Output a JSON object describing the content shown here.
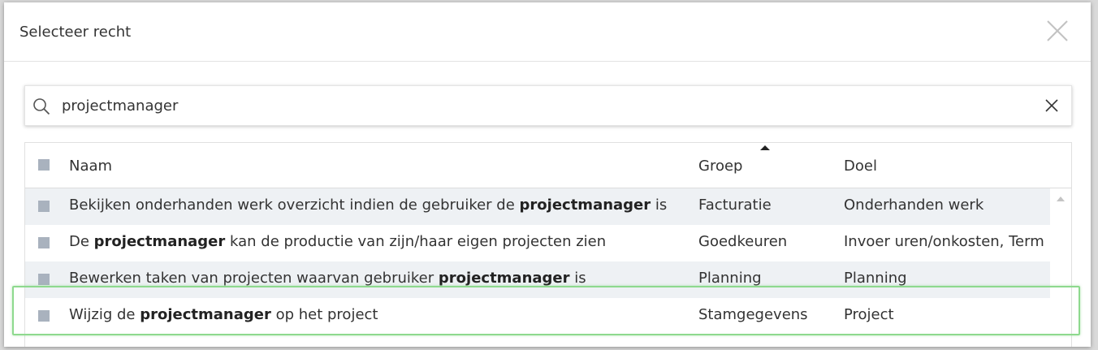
{
  "dialog": {
    "title": "Selecteer recht"
  },
  "search": {
    "value": "projectmanager",
    "placeholder": ""
  },
  "table": {
    "columns": {
      "naam": "Naam",
      "groep": "Groep",
      "doel": "Doel"
    },
    "sorted_column": "Groep",
    "rows": [
      {
        "naam": [
          {
            "text": "Bekijken onderhanden werk overzicht indien de gebruiker de ",
            "bold": false
          },
          {
            "text": "projectmanager",
            "bold": true
          },
          {
            "text": " is",
            "bold": false
          }
        ],
        "groep": "Facturatie",
        "doel": "Onderhanden werk"
      },
      {
        "naam": [
          {
            "text": "De ",
            "bold": false
          },
          {
            "text": "projectmanager",
            "bold": true
          },
          {
            "text": " kan de productie van zijn/haar eigen projecten zien",
            "bold": false
          }
        ],
        "groep": "Goedkeuren",
        "doel": "Invoer uren/onkosten, Term"
      },
      {
        "naam": [
          {
            "text": "Bewerken taken van projecten waarvan gebruiker ",
            "bold": false
          },
          {
            "text": "projectmanager",
            "bold": true
          },
          {
            "text": " is",
            "bold": false
          }
        ],
        "groep": "Planning",
        "doel": "Planning"
      },
      {
        "naam": [
          {
            "text": "Wijzig de ",
            "bold": false
          },
          {
            "text": "projectmanager",
            "bold": true
          },
          {
            "text": " op het project",
            "bold": false
          }
        ],
        "groep": "Stamgegevens",
        "doel": "Project"
      }
    ]
  },
  "icons": {
    "close": "close-icon",
    "search": "search-icon",
    "clear": "clear-search-icon"
  },
  "colors": {
    "checkbox": "#a9b2be",
    "row_alt": "#eef1f4",
    "highlight": "#8ed98e"
  }
}
